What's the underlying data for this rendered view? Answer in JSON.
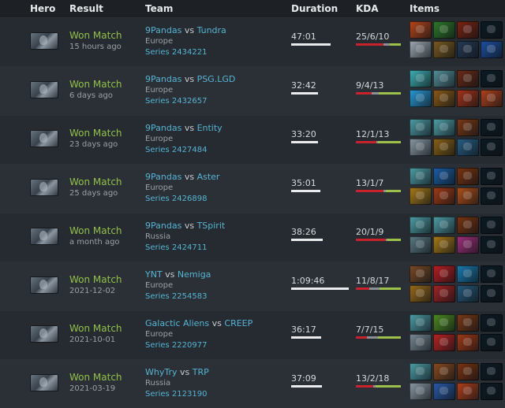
{
  "headers": {
    "hero": "Hero",
    "result": "Result",
    "team": "Team",
    "duration": "Duration",
    "kda": "KDA",
    "items": "Items"
  },
  "matches": [
    {
      "result": "Won Match",
      "when": "15 hours ago",
      "team1": "9Pandas",
      "vs": "vs",
      "team2": "Tundra",
      "region": "Europe",
      "series": "Series 2434221",
      "duration": "47:01",
      "duration_fraction": 0.68,
      "kda": "25/6/10",
      "kda_values": [
        25,
        6,
        10
      ],
      "items": [
        "#b8461c",
        "#2e7a2a",
        "#7a2412",
        "#0c1a24",
        "#9fa9b3",
        "#7b5a20",
        "#253a55",
        "#1c4fa0"
      ]
    },
    {
      "result": "Won Match",
      "when": "6 days ago",
      "team1": "9Pandas",
      "vs": "vs",
      "team2": "PSG.LGD",
      "region": "Europe",
      "series": "Series 2432657",
      "duration": "32:42",
      "duration_fraction": 0.46,
      "kda": "9/4/13",
      "kda_values": [
        9,
        4,
        13
      ],
      "items": [
        "#3fb0b5",
        "#55909c",
        "#6a2a18",
        "#0c1a24",
        "#2a9ad6",
        "#8a5a18",
        "#a6341a",
        "#b0421c"
      ]
    },
    {
      "result": "Won Match",
      "when": "23 days ago",
      "team1": "9Pandas",
      "vs": "vs",
      "team2": "Entity",
      "region": "Europe",
      "series": "Series 2427484",
      "duration": "33:20",
      "duration_fraction": 0.47,
      "kda": "12/1/13",
      "kda_values": [
        12,
        1,
        13
      ],
      "items": [
        "#4f9ea6",
        "#4fa0a8",
        "#7a3a16",
        "#0c1a24",
        "#8b99a4",
        "#8a6216",
        "#275e84",
        "#0c1a24"
      ]
    },
    {
      "result": "Won Match",
      "when": "25 days ago",
      "team1": "9Pandas",
      "vs": "vs",
      "team2": "Aster",
      "region": "Europe",
      "series": "Series 2426898",
      "duration": "35:01",
      "duration_fraction": 0.5,
      "kda": "13/1/7",
      "kda_values": [
        13,
        1,
        7
      ],
      "items": [
        "#4f9ea6",
        "#1c5ea6",
        "#7a3412",
        "#0c1a24",
        "#a77a1a",
        "#a23a16",
        "#b0501a",
        "#0c1a24"
      ]
    },
    {
      "result": "Won Match",
      "when": "a month ago",
      "team1": "9Pandas",
      "vs": "vs",
      "team2": "TSpirit",
      "region": "Russia",
      "series": "Series 2424711",
      "duration": "38:26",
      "duration_fraction": 0.55,
      "kda": "20/1/9",
      "kda_values": [
        20,
        1,
        9
      ],
      "items": [
        "#4f9ea6",
        "#4f9ea6",
        "#7a3412",
        "#0c1a24",
        "#5c7a84",
        "#a77a1a",
        "#a0307a",
        "#0c1a24"
      ]
    },
    {
      "result": "Won Match",
      "when": "2021-12-02",
      "team1": "YNT",
      "vs": "vs",
      "team2": "Nemiga",
      "region": "Europe",
      "series": "Series 2254583",
      "duration": "1:09:46",
      "duration_fraction": 1.0,
      "kda": "11/8/17",
      "kda_values": [
        11,
        8,
        17
      ],
      "items": [
        "#7a4a26",
        "#b81e24",
        "#1a7ab0",
        "#0c1a24",
        "#9a6a1c",
        "#a22424",
        "#27587a",
        "#0c1a24"
      ]
    },
    {
      "result": "Won Match",
      "when": "2021-10-01",
      "team1": "Galactic Aliens",
      "vs": "vs",
      "team2": "CREEP",
      "region": "Europe",
      "series": "Series 2220977",
      "duration": "36:17",
      "duration_fraction": 0.52,
      "kda": "7/7/15",
      "kda_values": [
        7,
        7,
        15
      ],
      "items": [
        "#4f9ea6",
        "#4d8a22",
        "#7a3a16",
        "#0c1a24",
        "#7a8a96",
        "#b82424",
        "#a23a16",
        "#0c1a24"
      ]
    },
    {
      "result": "Won Match",
      "when": "2021-03-19",
      "team1": "WhyTry",
      "vs": "vs",
      "team2": "TRP",
      "region": "Russia",
      "series": "Series 2123190",
      "duration": "37:09",
      "duration_fraction": 0.53,
      "kda": "13/2/18",
      "kda_values": [
        13,
        2,
        18
      ],
      "items": [
        "#4f9ea6",
        "#8a4a20",
        "#7a3412",
        "#0c1a24",
        "#8b99a4",
        "#2a5aa6",
        "#b0401c",
        "#0c1a24"
      ]
    }
  ]
}
